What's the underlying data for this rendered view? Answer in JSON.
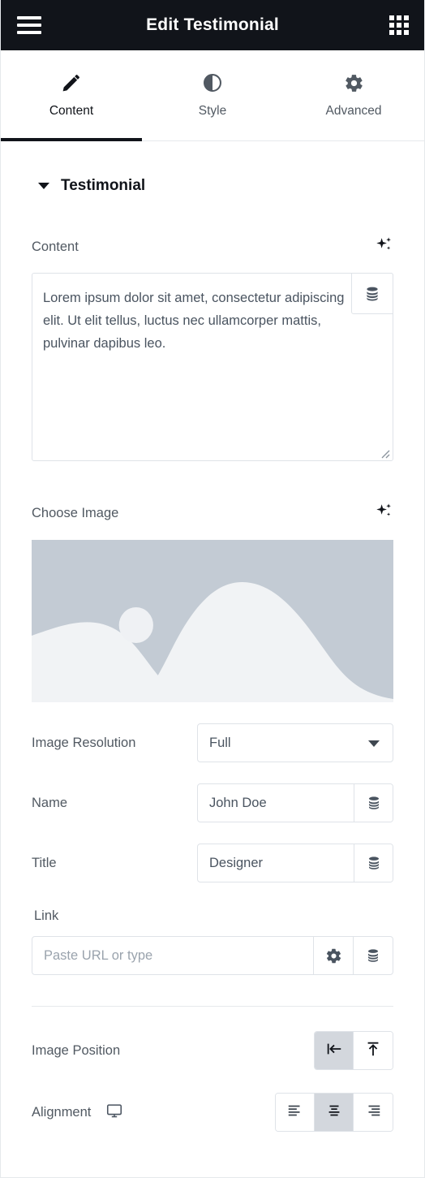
{
  "titlebar": {
    "menu_icon": "hamburger-icon",
    "title": "Edit Testimonial",
    "widgets_icon": "grid-icon"
  },
  "tabs": [
    {
      "label": "Content",
      "icon": "pencil-icon",
      "active": true
    },
    {
      "label": "Style",
      "icon": "contrast-icon",
      "active": false
    },
    {
      "label": "Advanced",
      "icon": "gear-icon",
      "active": false
    }
  ],
  "section": {
    "title": "Testimonial",
    "collapse_icon": "chevron-down-icon",
    "expanded": true
  },
  "content_field": {
    "label": "Content",
    "ai_icon": "ai-sparkle-icon",
    "value": "Lorem ipsum dolor sit amet, consectetur adipiscing elit. Ut elit tellus, luctus nec ullamcorper mattis, pulvinar dapibus leo.",
    "dynamic_icon": "database-icon",
    "resize_icon": "resize-handle-icon"
  },
  "image_field": {
    "label": "Choose Image",
    "ai_icon": "ai-sparkle-icon",
    "placeholder_icon": "image-placeholder-landscape",
    "colors": {
      "sky": "#c3cbd4",
      "hills": "#f1f3f5"
    }
  },
  "image_resolution": {
    "label": "Image Resolution",
    "value": "Full",
    "arrow_icon": "chevron-down-icon"
  },
  "name_field": {
    "label": "Name",
    "value": "John Doe",
    "dynamic_icon": "database-icon"
  },
  "title_field": {
    "label": "Title",
    "value": "Designer",
    "dynamic_icon": "database-icon"
  },
  "link_field": {
    "label": "Link",
    "placeholder": "Paste URL or type",
    "value": "",
    "options_icon": "gear-icon",
    "dynamic_icon": "database-icon"
  },
  "image_position": {
    "label": "Image Position",
    "options": [
      {
        "name": "aside",
        "icon": "align-to-left-bar-icon",
        "selected": true
      },
      {
        "name": "top",
        "icon": "align-to-top-bar-icon",
        "selected": false
      }
    ]
  },
  "alignment": {
    "label": "Alignment",
    "device_icon": "desktop-icon",
    "options": [
      {
        "name": "left",
        "icon": "align-left-icon",
        "selected": false
      },
      {
        "name": "center",
        "icon": "align-center-icon",
        "selected": true
      },
      {
        "name": "right",
        "icon": "align-right-icon",
        "selected": false
      }
    ]
  },
  "colors": {
    "header_bg": "#11141a",
    "accent_text": "#ffffff",
    "label_text": "#515962",
    "value_text": "#4a5460",
    "placeholder_text": "#9aa3ad",
    "border": "#dfe3e8",
    "selected_bg": "#d3d7dd"
  }
}
